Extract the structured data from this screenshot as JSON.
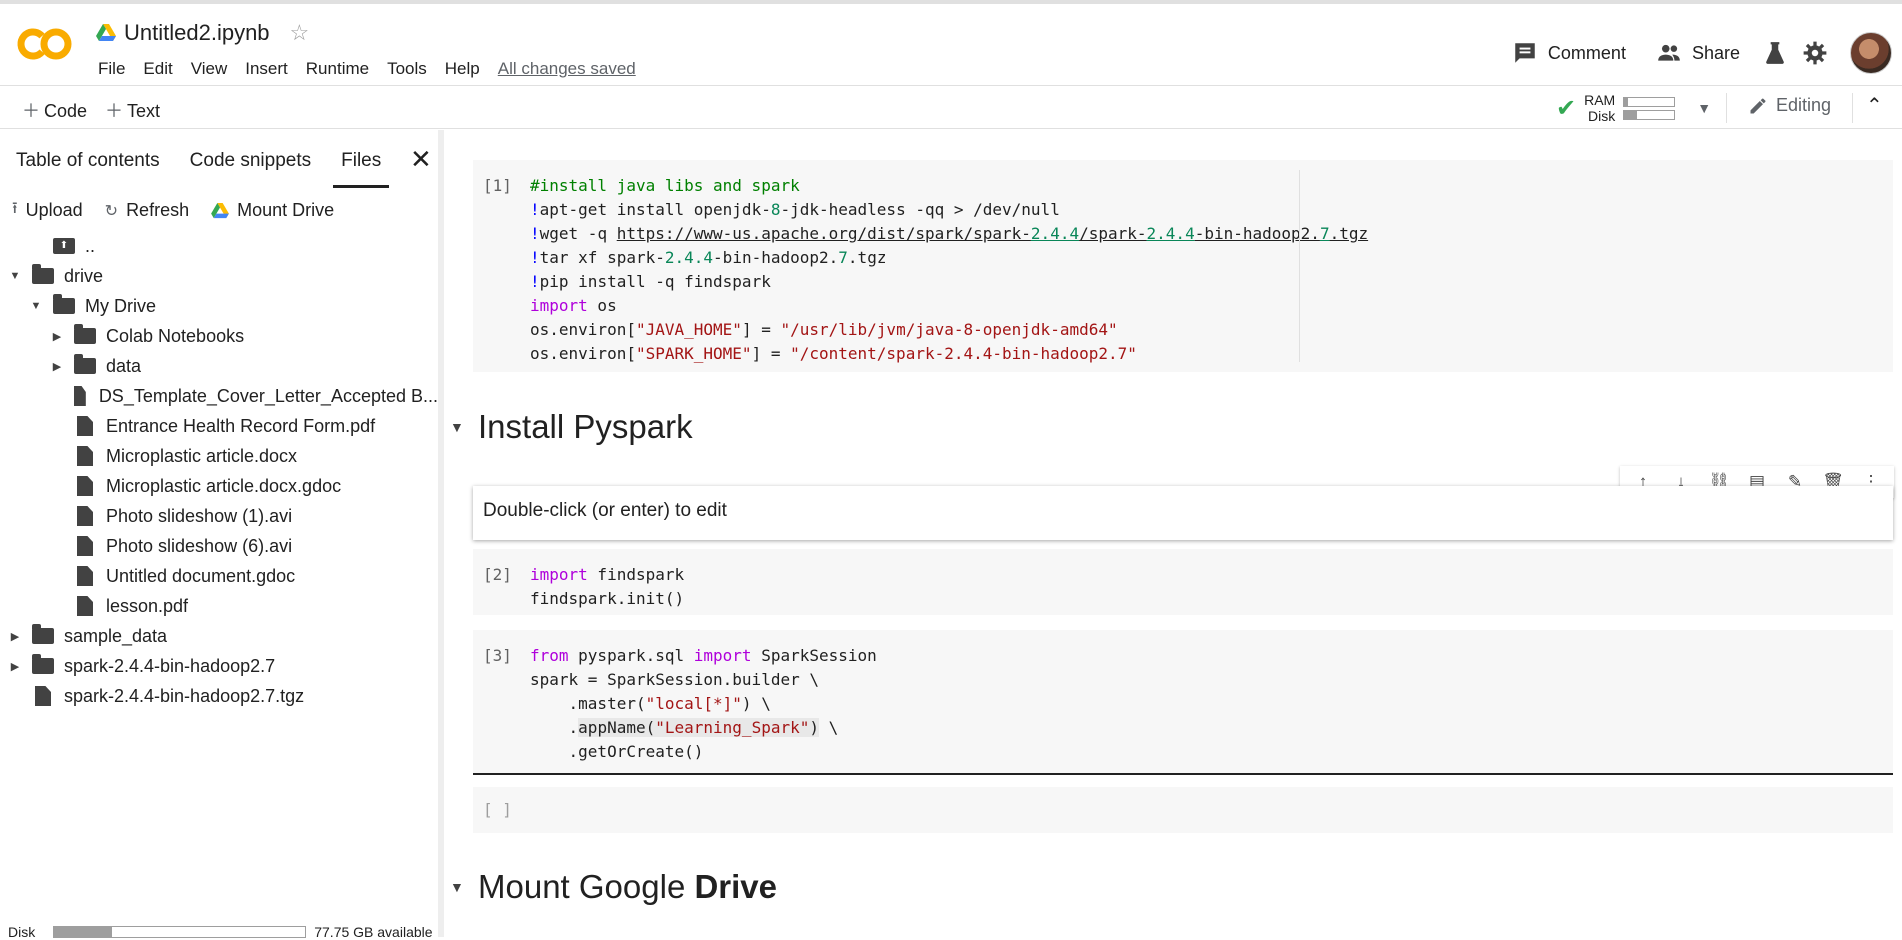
{
  "app": {
    "notebook_title": "Untitled2.ipynb",
    "menu": [
      "File",
      "Edit",
      "View",
      "Insert",
      "Runtime",
      "Tools",
      "Help"
    ],
    "save_status": "All changes saved",
    "comment_label": "Comment",
    "share_label": "Share"
  },
  "toolbar": {
    "add_code_label": "Code",
    "add_text_label": "Text",
    "ram_label": "RAM",
    "disk_label": "Disk",
    "ram_usage": 0.08,
    "disk_usage": 0.25,
    "editing_label": "Editing",
    "check_color": "#34a853"
  },
  "sidebar": {
    "tabs": [
      "Table of contents",
      "Code snippets",
      "Files"
    ],
    "active_tab": "Files",
    "actions": {
      "upload": "Upload",
      "refresh": "Refresh",
      "mount_drive": "Mount Drive"
    },
    "tree": [
      {
        "name": "..",
        "type": "parent",
        "depth": 1,
        "arrow": ""
      },
      {
        "name": "drive",
        "type": "folder",
        "depth": 0,
        "arrow": "open"
      },
      {
        "name": "My Drive",
        "type": "folder",
        "depth": 1,
        "arrow": "open"
      },
      {
        "name": "Colab Notebooks",
        "type": "folder",
        "depth": 2,
        "arrow": "closed"
      },
      {
        "name": "data",
        "type": "folder",
        "depth": 2,
        "arrow": "closed"
      },
      {
        "name": "DS_Template_Cover_Letter_Accepted B...",
        "type": "file",
        "depth": 2,
        "arrow": ""
      },
      {
        "name": "Entrance Health Record Form.pdf",
        "type": "file",
        "depth": 2,
        "arrow": ""
      },
      {
        "name": "Microplastic article.docx",
        "type": "file",
        "depth": 2,
        "arrow": ""
      },
      {
        "name": "Microplastic article.docx.gdoc",
        "type": "file",
        "depth": 2,
        "arrow": ""
      },
      {
        "name": "Photo slideshow (1).avi",
        "type": "file",
        "depth": 2,
        "arrow": ""
      },
      {
        "name": "Photo slideshow (6).avi",
        "type": "file",
        "depth": 2,
        "arrow": ""
      },
      {
        "name": "Untitled document.gdoc",
        "type": "file",
        "depth": 2,
        "arrow": ""
      },
      {
        "name": "lesson.pdf",
        "type": "file",
        "depth": 2,
        "arrow": ""
      },
      {
        "name": "sample_data",
        "type": "folder",
        "depth": 0,
        "arrow": "closed"
      },
      {
        "name": "spark-2.4.4-bin-hadoop2.7",
        "type": "folder",
        "depth": 0,
        "arrow": "closed"
      },
      {
        "name": "spark-2.4.4-bin-hadoop2.7.tgz",
        "type": "file",
        "depth": 0,
        "arrow": ""
      }
    ],
    "disk_label": "Disk",
    "disk_available": "77.75 GB available",
    "disk_usage": 0.23
  },
  "notebook": {
    "cell1": {
      "count": "[1]",
      "lines": [
        [
          [
            "cmt",
            "#install java libs and spark"
          ]
        ],
        [
          [
            "bang",
            "!"
          ],
          [
            "",
            "apt-get install openjdk-"
          ],
          [
            "num",
            "8"
          ],
          [
            "",
            "-jdk-headless -qq > /dev/null"
          ]
        ],
        [
          [
            "bang",
            "!"
          ],
          [
            "",
            "wget -q "
          ],
          [
            "url",
            "https://www-us.apache.org/dist/spark/spark-"
          ],
          [
            "url num",
            "2.4.4"
          ],
          [
            "url",
            "/spark-"
          ],
          [
            "url num",
            "2.4.4"
          ],
          [
            "url",
            "-bin-hadoop2."
          ],
          [
            "url num",
            "7"
          ],
          [
            "url",
            ".tgz"
          ]
        ],
        [
          [
            "bang",
            "!"
          ],
          [
            "",
            "tar xf spark-"
          ],
          [
            "num",
            "2.4.4"
          ],
          [
            "",
            "-bin-hadoop2."
          ],
          [
            "num",
            "7"
          ],
          [
            "",
            ".tgz"
          ]
        ],
        [
          [
            "bang",
            "!"
          ],
          [
            "",
            "pip install -q findspark"
          ]
        ],
        [
          [
            "kw",
            "import"
          ],
          [
            "",
            " os"
          ]
        ],
        [
          [
            "",
            "os.environ["
          ],
          [
            "str",
            "\"JAVA_HOME\""
          ],
          [
            "",
            "] = "
          ],
          [
            "str",
            "\"/usr/lib/jvm/java-8-openjdk-amd64\""
          ]
        ],
        [
          [
            "",
            "os.environ["
          ],
          [
            "str",
            "\"SPARK_HOME\""
          ],
          [
            "",
            "] = "
          ],
          [
            "str",
            "\"/content/spark-2.4.4-bin-hadoop2.7\""
          ]
        ]
      ]
    },
    "heading1": "Install Pyspark",
    "text_cell_placeholder": "Double-click (or enter) to edit",
    "cell2": {
      "count": "[2]",
      "lines": [
        [
          [
            "kw",
            "import"
          ],
          [
            "",
            " findspark"
          ]
        ],
        [
          [
            "",
            "findspark.init()"
          ]
        ]
      ]
    },
    "cell3": {
      "count": "[3]",
      "lines": [
        [
          [
            "kw",
            "from"
          ],
          [
            "",
            " pyspark.sql "
          ],
          [
            "kw",
            "import"
          ],
          [
            "",
            " SparkSession"
          ]
        ],
        [
          [
            "",
            "spark = SparkSession.builder \\"
          ]
        ],
        [
          [
            "",
            "    .master("
          ],
          [
            "str",
            "\"local[*]\""
          ],
          [
            "",
            ") \\"
          ]
        ],
        [
          [
            "",
            "    ."
          ],
          [
            "hl",
            "appName("
          ],
          [
            "str hl",
            "\"Learning_Spark\""
          ],
          [
            "hl",
            ")"
          ],
          [
            "",
            " \\"
          ]
        ],
        [
          [
            "",
            "    .getOrCreate()"
          ]
        ]
      ]
    },
    "empty_cell_count": "[ ]",
    "heading2_plain": "Mount Google ",
    "heading2_bold": "Drive"
  }
}
